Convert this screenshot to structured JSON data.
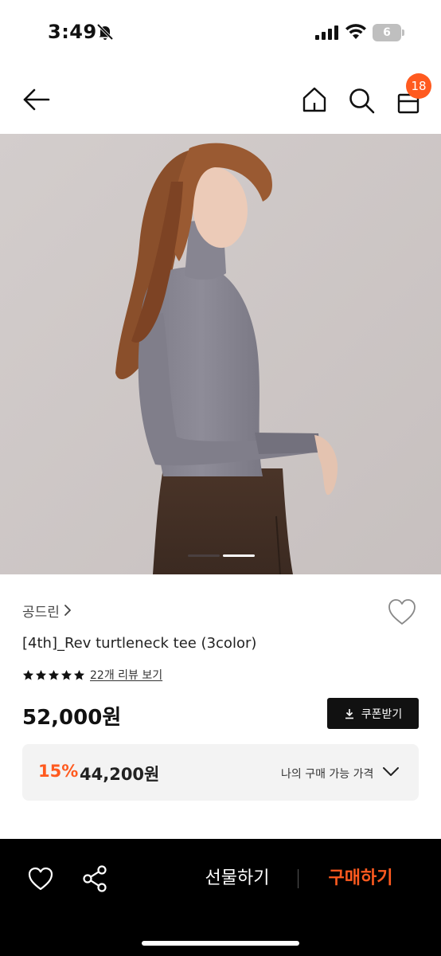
{
  "status_bar": {
    "time": "3:49",
    "battery": "6",
    "icons": [
      "bell-slash-icon",
      "signal-icon",
      "wifi-icon",
      "battery-icon"
    ]
  },
  "nav": {
    "icons": [
      "back-arrow-icon",
      "home-icon",
      "search-icon",
      "shopping-bag-icon"
    ],
    "cart_count": "18"
  },
  "product": {
    "brand": "공드린",
    "title": "[4th]_Rev turtleneck tee (3color)",
    "rating_stars": 5,
    "review_link": "22개 리뷰 보기",
    "price": "52,000원",
    "coupon_label": "쿠폰받기",
    "discount_rate": "15%",
    "discount_price": "44,200원",
    "my_price_label": "나의 구매 가능 가격",
    "image_count": 2,
    "current_image": 1
  },
  "bottom_bar": {
    "gift_label": "선물하기",
    "buy_label": "구매하기",
    "icons": [
      "heart-icon",
      "share-icon"
    ]
  },
  "colors": {
    "accent": "#ff5a1f",
    "dark": "#111111",
    "panel": "#f3f3f3"
  }
}
